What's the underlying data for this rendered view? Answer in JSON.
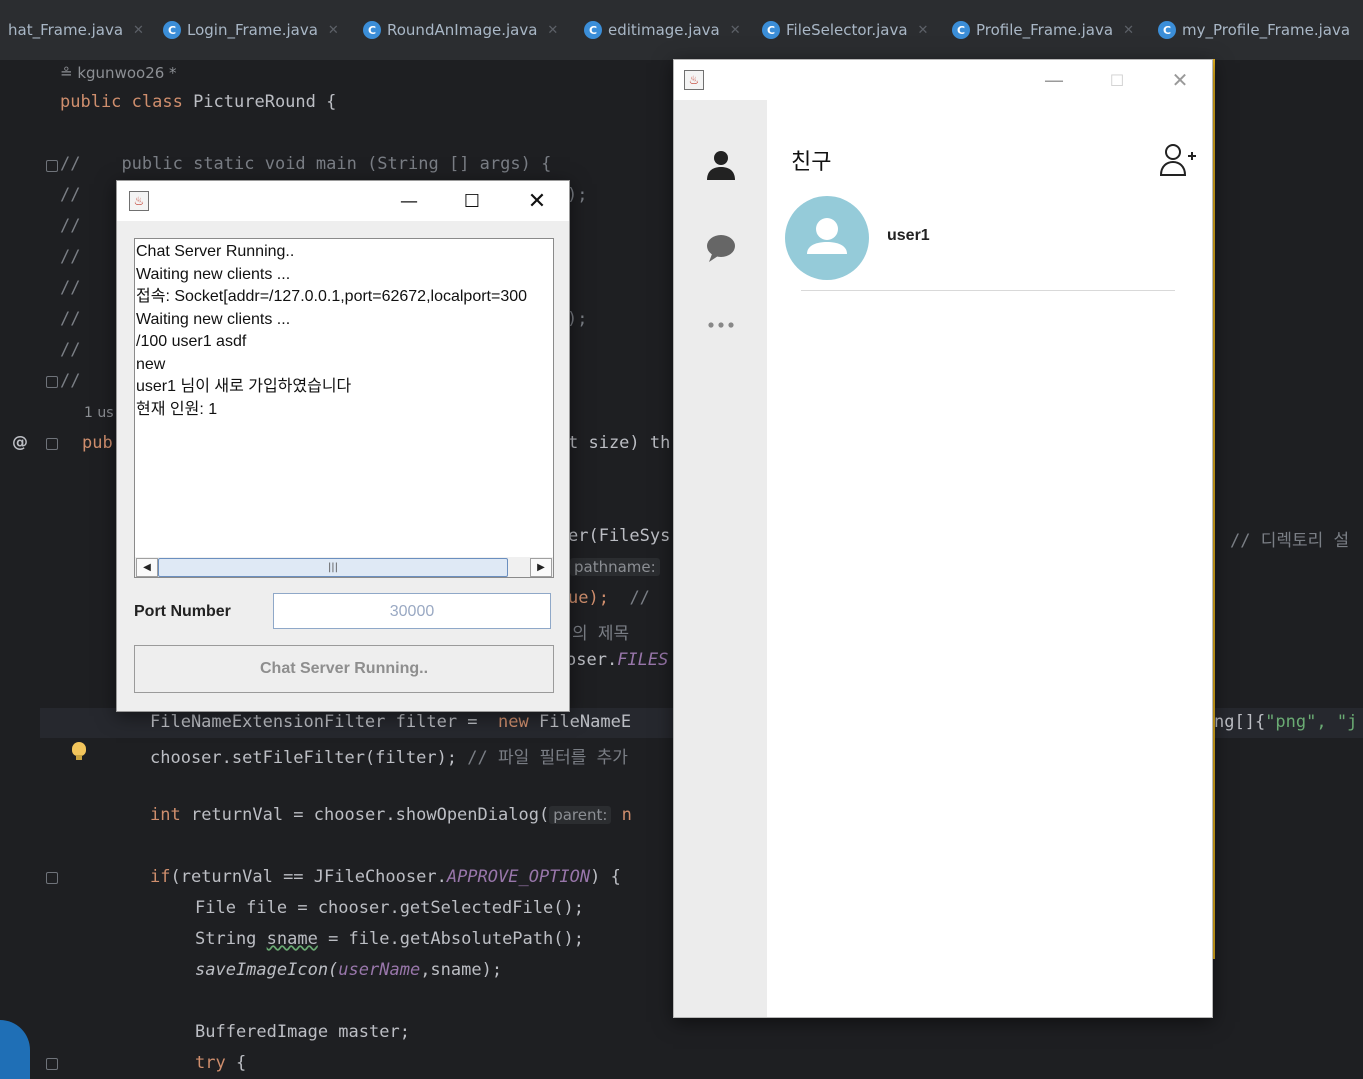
{
  "ide": {
    "tabs": [
      {
        "label": "hat_Frame.java"
      },
      {
        "label": "Login_Frame.java"
      },
      {
        "label": "RoundAnImage.java"
      },
      {
        "label": "editimage.java"
      },
      {
        "label": "FileSelector.java"
      },
      {
        "label": "Profile_Frame.java"
      },
      {
        "label": "my_Profile_Frame.java"
      }
    ],
    "author": "kgunwoo26 *",
    "usage_hint": "1 us",
    "param_hints": {
      "pathname": "pathname:",
      "parent": "parent:"
    },
    "code": {
      "class_line_kw": "public class ",
      "class_line_name": "PictureRound {",
      "main_line": "public static void main (String [] args) {",
      "comment_slashes": "//",
      "pub_frag": "pub",
      "size_frag": "t size) th",
      "filesys_frag": "er(FileSys",
      "ue_frag": "ue);",
      "ue_comment": "//",
      "title_comment": "의 제목",
      "chooser_frag": "oser.",
      "chooser_files": "FILES",
      "dir_comment": "// 디렉토리 설",
      "png_frag_a": "ng[]{",
      "png_frag_b": "\"png\", \"j",
      "filter_kw": "FileNameExtensionFilter",
      "filter_var": " filter = ",
      "filter_new": "new",
      "filter_cls": " FileNameE",
      "setfilter": "chooser.setFileFilter(filter);",
      "setfilter_comment": " // 파일 필터를 추가",
      "int_kw": "int",
      "returnval": " returnVal = chooser.showOpenDialog(",
      "returnval_n": "n",
      "if_kw": "if",
      "if_expr": "(returnVal == JFileChooser.",
      "approve": "APPROVE_OPTION",
      "if_end": ") {",
      "file_line": "File file = chooser.getSelectedFile();",
      "sname_a": "String ",
      "sname_b": "sname",
      "sname_c": " = file.getAbsolutePath();",
      "save_fn": "saveImageIcon(",
      "save_arg": "userName",
      "save_end": ",sname);",
      "buffered": "BufferedImage master;",
      "try_kw": "try",
      "try_end": " {",
      "paren_sc": ");",
      "brace_open": " {"
    },
    "at_symbol": "@"
  },
  "server_window": {
    "log_lines": [
      "Chat Server Running..",
      "Waiting new clients ...",
      "접속: Socket[addr=/127.0.0.1,port=62672,localport=300",
      "Waiting new clients ...",
      "/100 user1 asdf",
      "new",
      "user1 님이 새로 가입하였습니다",
      "현재 인원: 1"
    ],
    "port_label": "Port Number",
    "port_value": "30000",
    "status_button": "Chat Server Running..",
    "scroll_position": 0
  },
  "friend_window": {
    "title": "친구",
    "friends": [
      {
        "name": "user1"
      }
    ],
    "nav": [
      {
        "icon": "person-icon",
        "active": true
      },
      {
        "icon": "chat-bubble-icon",
        "active": false
      },
      {
        "icon": "more-icon",
        "active": false
      }
    ],
    "accent_color": "#e8b41e",
    "avatar_color": "#95cbd9"
  }
}
